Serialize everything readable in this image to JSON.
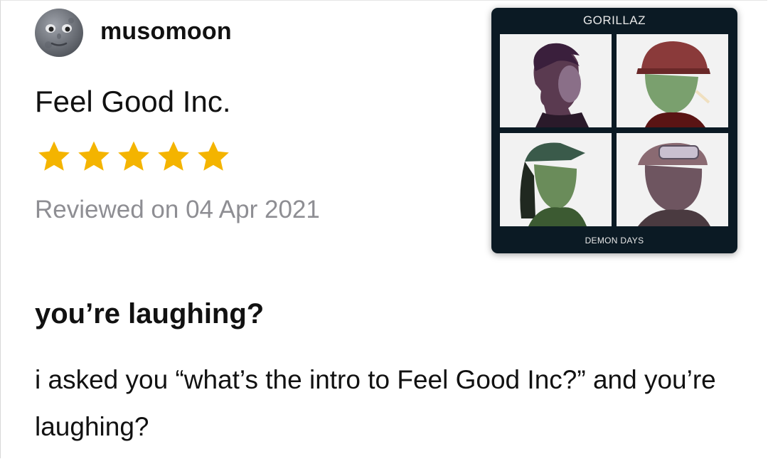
{
  "review": {
    "username": "musomoon",
    "avatar_icon": "moon-face-icon",
    "song_title": "Feel Good Inc.",
    "rating": 5,
    "rating_max": 5,
    "star_color": "#f4b400",
    "date_text": "Reviewed on 04 Apr 2021",
    "heading": "you’re laughing?",
    "body": "i asked you “what’s the intro to Feel Good Inc?” and you’re laughing?"
  },
  "album": {
    "artist": "GORILLAZ",
    "title": "DEMON DAYS"
  }
}
